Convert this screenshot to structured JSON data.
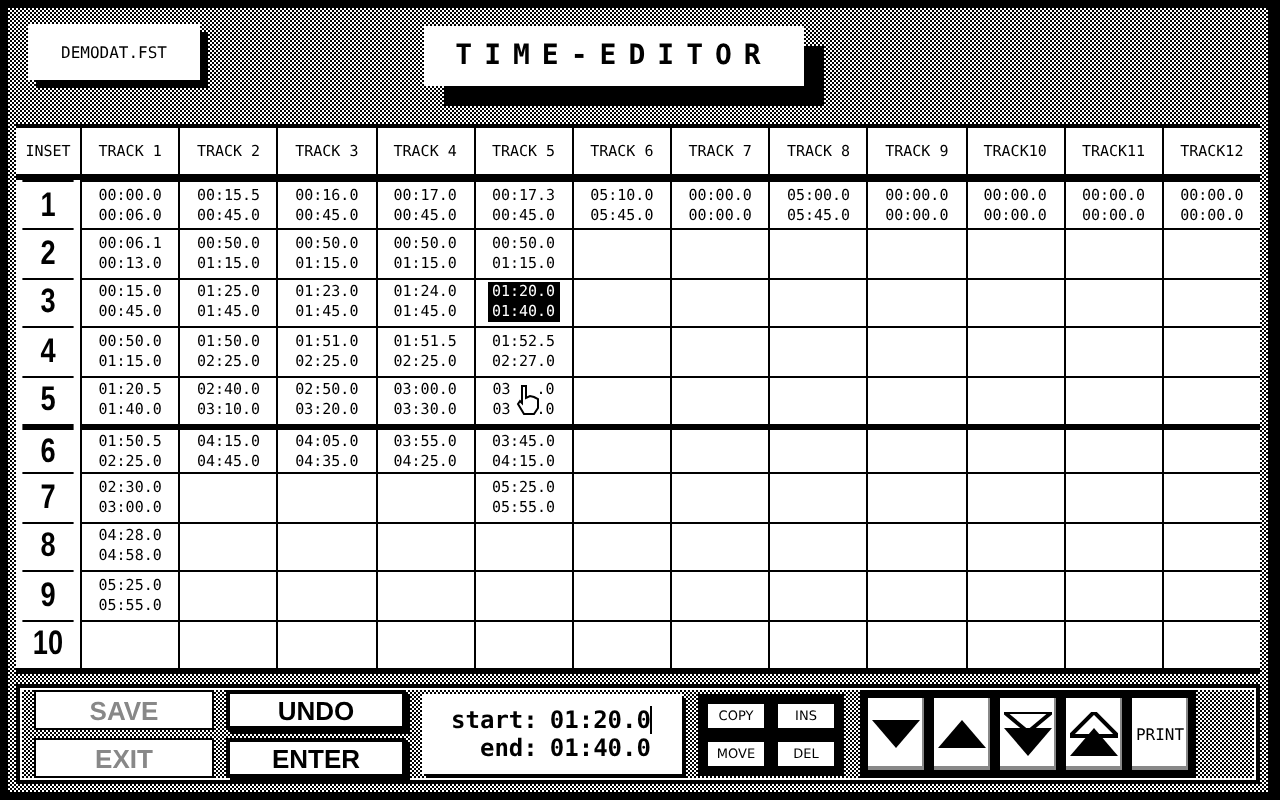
{
  "file_label": "DEMODAT.FST",
  "title": "TIME-EDITOR",
  "columns": [
    "INSET",
    "TRACK 1",
    "TRACK 2",
    "TRACK 3",
    "TRACK 4",
    "TRACK 5",
    "TRACK 6",
    "TRACK 7",
    "TRACK 8",
    "TRACK 9",
    "TRACK10",
    "TRACK11",
    "TRACK12"
  ],
  "rows": [
    {
      "label": "1",
      "cells": [
        {
          "start": "00:00.0",
          "end": "00:06.0",
          "selected": false
        },
        {
          "start": "00:15.5",
          "end": "00:45.0",
          "selected": false
        },
        {
          "start": "00:16.0",
          "end": "00:45.0",
          "selected": false
        },
        {
          "start": "00:17.0",
          "end": "00:45.0",
          "selected": false
        },
        {
          "start": "00:17.3",
          "end": "00:45.0",
          "selected": false
        },
        {
          "start": "05:10.0",
          "end": "05:45.0",
          "selected": false
        },
        {
          "start": "00:00.0",
          "end": "00:00.0",
          "selected": false
        },
        {
          "start": "05:00.0",
          "end": "05:45.0",
          "selected": false
        },
        {
          "start": "00:00.0",
          "end": "00:00.0",
          "selected": false
        },
        {
          "start": "00:00.0",
          "end": "00:00.0",
          "selected": false
        },
        {
          "start": "00:00.0",
          "end": "00:00.0",
          "selected": false
        },
        {
          "start": "00:00.0",
          "end": "00:00.0",
          "selected": false
        }
      ]
    },
    {
      "label": "2",
      "cells": [
        {
          "start": "00:06.1",
          "end": "00:13.0",
          "selected": false
        },
        {
          "start": "00:50.0",
          "end": "01:15.0",
          "selected": false
        },
        {
          "start": "00:50.0",
          "end": "01:15.0",
          "selected": false
        },
        {
          "start": "00:50.0",
          "end": "01:15.0",
          "selected": false
        },
        {
          "start": "00:50.0",
          "end": "01:15.0",
          "selected": false
        }
      ]
    },
    {
      "label": "3",
      "cells": [
        {
          "start": "00:15.0",
          "end": "00:45.0",
          "selected": false
        },
        {
          "start": "01:25.0",
          "end": "01:45.0",
          "selected": false
        },
        {
          "start": "01:23.0",
          "end": "01:45.0",
          "selected": false
        },
        {
          "start": "01:24.0",
          "end": "01:45.0",
          "selected": false
        },
        {
          "start": "01:20.0",
          "end": "01:40.0",
          "selected": true
        }
      ]
    },
    {
      "label": "4",
      "cells": [
        {
          "start": "00:50.0",
          "end": "01:15.0",
          "selected": false
        },
        {
          "start": "01:50.0",
          "end": "02:25.0",
          "selected": false
        },
        {
          "start": "01:51.0",
          "end": "02:25.0",
          "selected": false
        },
        {
          "start": "01:51.5",
          "end": "02:25.0",
          "selected": false
        },
        {
          "start": "01:52.5",
          "end": "02:27.0",
          "selected": false
        }
      ]
    },
    {
      "label": "5",
      "cells": [
        {
          "start": "01:20.5",
          "end": "01:40.0",
          "selected": false
        },
        {
          "start": "02:40.0",
          "end": "03:10.0",
          "selected": false
        },
        {
          "start": "02:50.0",
          "end": "03:20.0",
          "selected": false
        },
        {
          "start": "03:00.0",
          "end": "03:30.0",
          "selected": false
        },
        {
          "start": "03",
          "start_rest": ".0",
          "end": "03",
          "end_rest": ".0",
          "selected": false,
          "cursor": true
        }
      ]
    },
    {
      "label": "6",
      "cells": [
        {
          "start": "01:50.5",
          "end": "02:25.0",
          "selected": false
        },
        {
          "start": "04:15.0",
          "end": "04:45.0",
          "selected": false
        },
        {
          "start": "04:05.0",
          "end": "04:35.0",
          "selected": false
        },
        {
          "start": "03:55.0",
          "end": "04:25.0",
          "selected": false
        },
        {
          "start": "03:45.0",
          "end": "04:15.0",
          "selected": false
        }
      ]
    },
    {
      "label": "7",
      "cells": [
        {
          "start": "02:30.0",
          "end": "03:00.0",
          "selected": false
        },
        null,
        null,
        null,
        {
          "start": "05:25.0",
          "end": "05:55.0",
          "selected": false
        }
      ]
    },
    {
      "label": "8",
      "cells": [
        {
          "start": "04:28.0",
          "end": "04:58.0",
          "selected": false
        }
      ]
    },
    {
      "label": "9",
      "cells": [
        {
          "start": "05:25.0",
          "end": "05:55.0",
          "selected": false
        }
      ]
    },
    {
      "label": "10",
      "cells": []
    }
  ],
  "buttons_left": [
    {
      "label": "SAVE",
      "disabled": true
    },
    {
      "label": "UNDO",
      "disabled": false
    },
    {
      "label": "EXIT",
      "disabled": true
    },
    {
      "label": "ENTER",
      "disabled": false
    }
  ],
  "range": {
    "start_label": "start:",
    "start": "01:20.0",
    "end_label": "end:",
    "end": "01:40.0"
  },
  "edit_buttons": [
    "COPY",
    "INS",
    "MOVE",
    "DEL"
  ],
  "nav_buttons": [
    {
      "kind": "down"
    },
    {
      "kind": "up"
    },
    {
      "kind": "page-down"
    },
    {
      "kind": "page-up"
    },
    {
      "kind": "print",
      "label": "PRINT"
    }
  ]
}
